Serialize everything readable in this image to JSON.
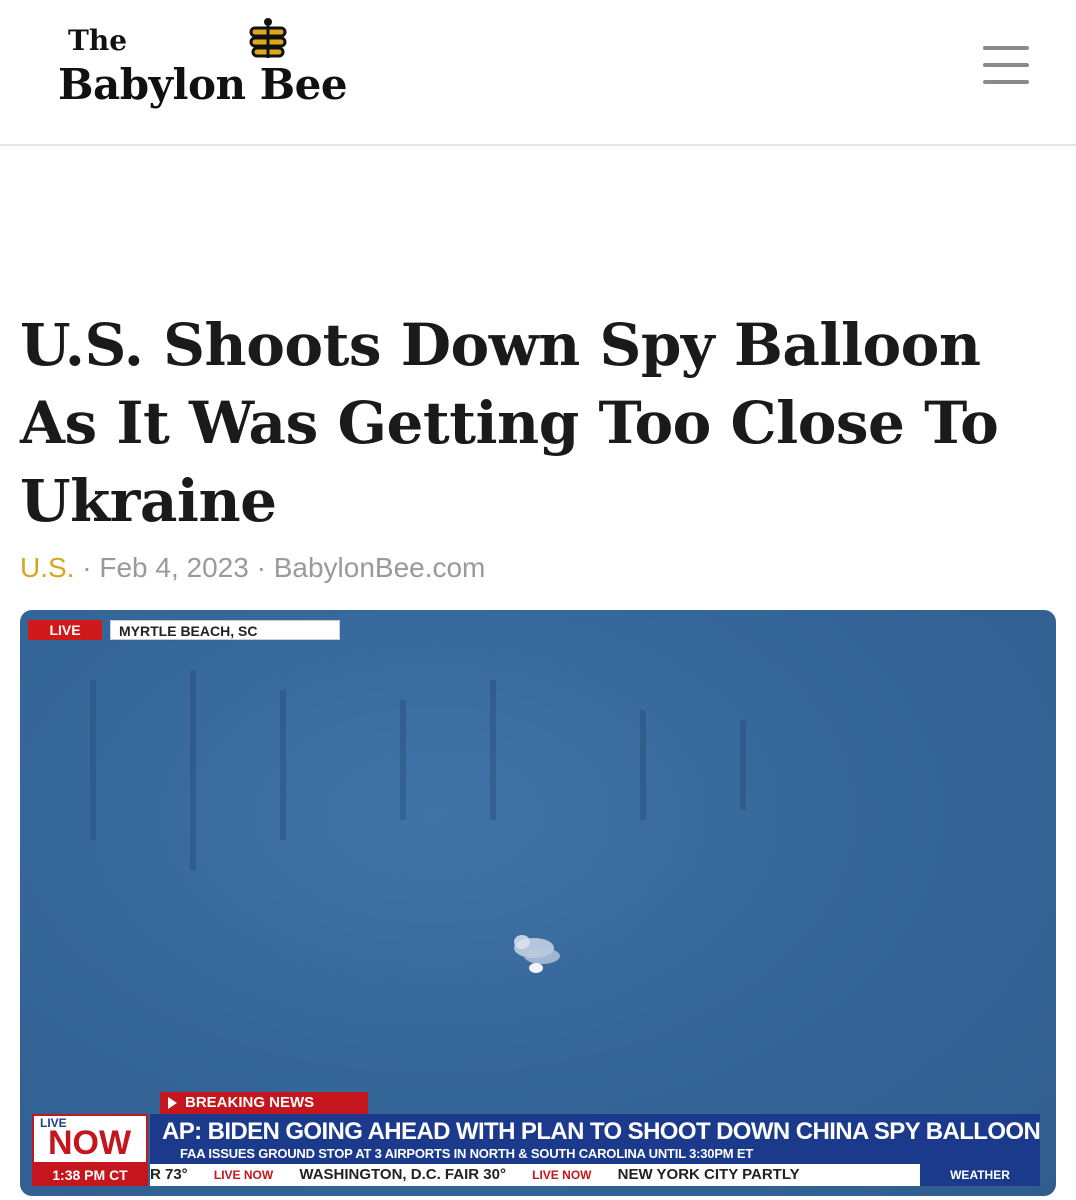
{
  "header": {
    "logo_line1": "The",
    "logo_line2": "Babylon Bee",
    "logo_icon": "bee-icon",
    "menu_icon": "hamburger-menu-icon",
    "brand_color": "#e0a91b"
  },
  "article": {
    "title": "U.S. Shoots Down Spy Balloon As It Was Getting Too Close To Ukraine",
    "category": "U.S.",
    "separator": "·",
    "date": "Feb 4, 2023",
    "source": "BabylonBee.com"
  },
  "video": {
    "live_label": "LIVE",
    "location": "MYRTLE BEACH, SC",
    "breaking_label": "BREAKING NEWS",
    "now_small": "LIVE",
    "now_big": "NOW",
    "time": "1:38 PM CT",
    "headline": "AP: BIDEN GOING AHEAD WITH PLAN TO SHOOT DOWN CHINA SPY BALLOON",
    "subheadline": "FAA ISSUES GROUND STOP AT 3 AIRPORTS IN NORTH & SOUTH CAROLINA UNTIL 3:30PM ET",
    "ticker": [
      "R 73°",
      "LIVE NOW",
      "WASHINGTON, D.C.  FAIR 30°",
      "LIVE NOW",
      "NEW YORK CITY  PARTLY"
    ],
    "weather_label": "WEATHER",
    "accent_red": "#c4161c",
    "accent_blue": "#1b3a8c",
    "sky_color": "#36679a"
  }
}
